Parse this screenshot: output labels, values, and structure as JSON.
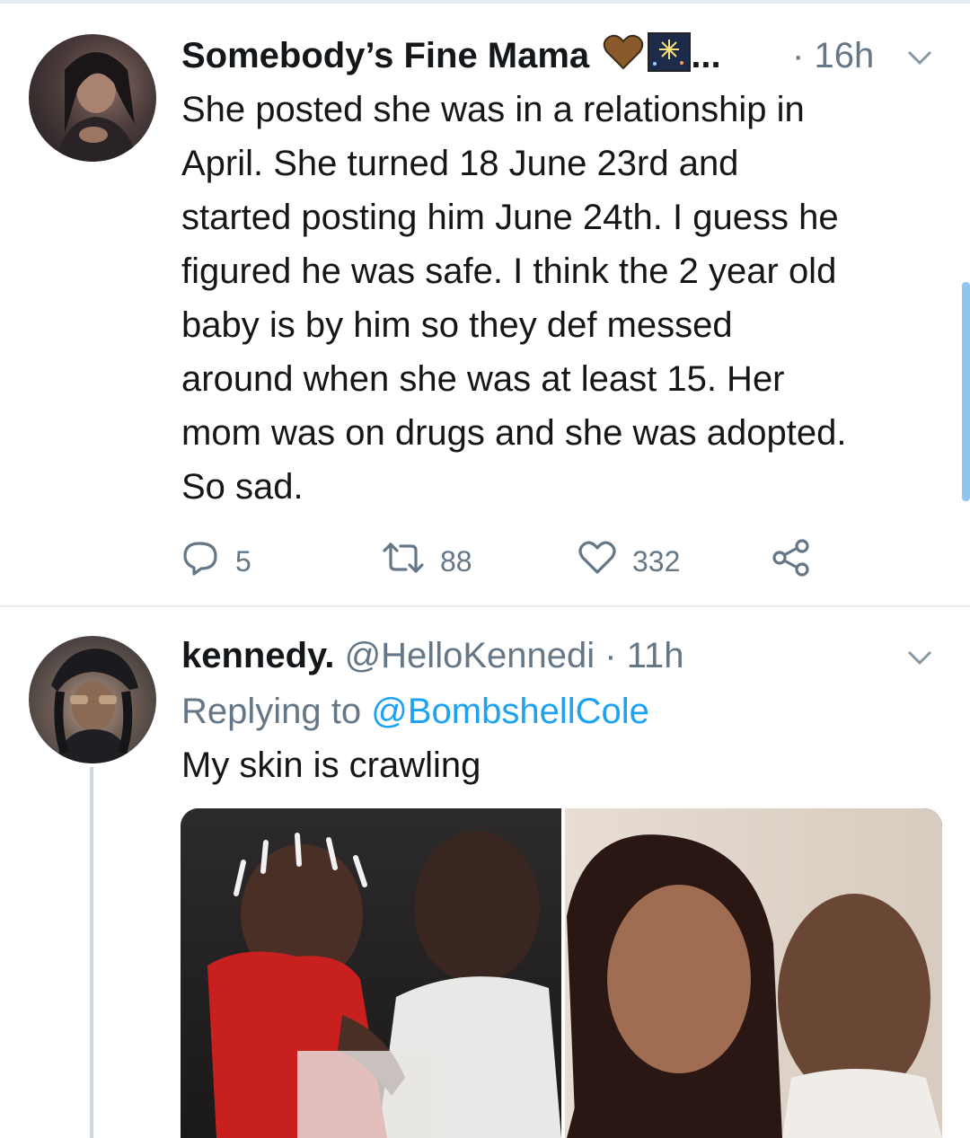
{
  "tweet1": {
    "display_name": "Somebody’s Fine Mama",
    "name_suffix": "...",
    "dot": "·",
    "time": "16h",
    "body": "She posted she was in a relationship in\nApril. She turned 18 June 23rd and\nstarted posting him June 24th. I guess he\nfigured he was safe. I think the 2 year old\nbaby is by him so they def messed\naround when she was at least 15. Her\nmom was on drugs and she was adopted.\nSo sad.",
    "actions": {
      "replies": "5",
      "retweets": "88",
      "likes": "332"
    }
  },
  "tweet2": {
    "display_name": "kennedy.",
    "handle": "@HelloKennedi",
    "dot": "·",
    "time": "11h",
    "replying_prefix": "Replying to",
    "replying_to": "@BombshellCole",
    "body": "My skin is crawling"
  },
  "colors": {
    "text": "#14171a",
    "secondary": "#657786",
    "link": "#1da1f2",
    "divider": "#e6ecf0"
  },
  "icons": {
    "reply": "reply-icon",
    "retweet": "retweet-icon",
    "like": "heart-icon",
    "share": "share-icon",
    "menu": "chevron-down-icon"
  }
}
